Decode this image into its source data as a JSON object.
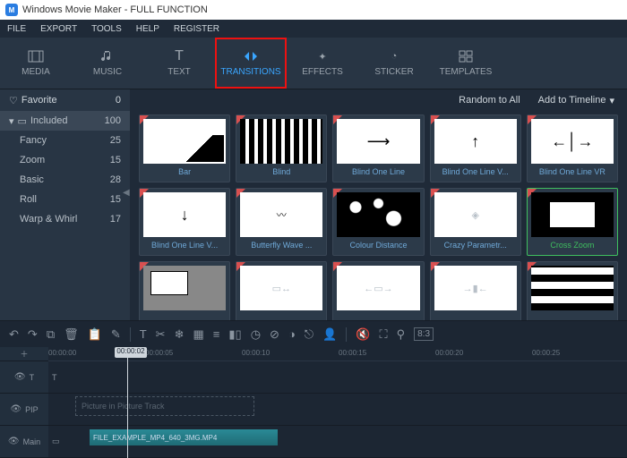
{
  "app": {
    "title": "Windows Movie Maker - FULL FUNCTION",
    "logo_letter": "M"
  },
  "menubar": [
    "FILE",
    "EXPORT",
    "TOOLS",
    "HELP",
    "REGISTER"
  ],
  "tabs": [
    {
      "label": "MEDIA",
      "icon": "media-icon"
    },
    {
      "label": "MUSIC",
      "icon": "music-icon"
    },
    {
      "label": "TEXT",
      "icon": "text-icon"
    },
    {
      "label": "TRANSITIONS",
      "icon": "transition-icon",
      "active": true,
      "highlighted": true
    },
    {
      "label": "EFFECTS",
      "icon": "effects-icon"
    },
    {
      "label": "STICKER",
      "icon": "sticker-icon"
    },
    {
      "label": "TEMPLATES",
      "icon": "templates-icon"
    }
  ],
  "sidebar": {
    "favorite_label": "Favorite",
    "favorite_count": "0",
    "categories": [
      {
        "name": "Included",
        "count": "100",
        "selected": true,
        "top": true
      },
      {
        "name": "Fancy",
        "count": "25"
      },
      {
        "name": "Zoom",
        "count": "15"
      },
      {
        "name": "Basic",
        "count": "28"
      },
      {
        "name": "Roll",
        "count": "15"
      },
      {
        "name": "Warp & Whirl",
        "count": "17"
      }
    ]
  },
  "content_header": {
    "random": "Random to All",
    "add": "Add to Timeline"
  },
  "transitions": [
    {
      "name": "Bar",
      "thumb": "stairs"
    },
    {
      "name": "Blind",
      "thumb": "blind"
    },
    {
      "name": "Blind One Line",
      "thumb": "arrowR"
    },
    {
      "name": "Blind One Line V...",
      "thumb": "arrowU"
    },
    {
      "name": "Blind One Line VR",
      "thumb": "splitV"
    },
    {
      "name": "Blind One Line V...",
      "thumb": "arrowD"
    },
    {
      "name": "Butterfly Wave ...",
      "thumb": "wave"
    },
    {
      "name": "Colour Distance",
      "thumb": "blobs"
    },
    {
      "name": "Crazy Parametr...",
      "thumb": "diamond"
    },
    {
      "name": "Cross Zoom",
      "thumb": "crosszoom",
      "selected": true
    },
    {
      "name": "",
      "thumb": "slide"
    },
    {
      "name": "",
      "thumb": "rect"
    },
    {
      "name": "",
      "thumb": "splitH"
    },
    {
      "name": "",
      "thumb": "splitH2"
    },
    {
      "name": "",
      "thumb": "waves"
    }
  ],
  "tl_tools": {
    "ratio": "8:3"
  },
  "ruler": {
    "ticks": [
      "00:00:00",
      "00:00:05",
      "00:00:10",
      "00:00:15",
      "00:00:20",
      "00:00:25"
    ],
    "playhead": "00:00:02"
  },
  "tracks": {
    "text_icon": "T",
    "pip_label": "PIP",
    "pip_placeholder": "Picture in Picture Track",
    "main_label": "Main",
    "clip_name": "FILE_EXAMPLE_MP4_640_3MG.MP4"
  }
}
